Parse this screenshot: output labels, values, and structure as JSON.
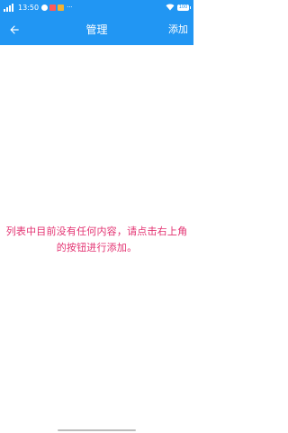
{
  "status_bar": {
    "time": "13:50",
    "battery": "100",
    "more": "···",
    "icons": [
      "signal-icon",
      "help-icon",
      "app-notification-icon",
      "app-notification-icon",
      "wifi-icon",
      "battery-icon"
    ]
  },
  "app_bar": {
    "title": "管理",
    "add_label": "添加",
    "back_icon": "arrow-left-icon",
    "color": "#2196F3"
  },
  "content": {
    "empty_message": "列表中目前没有任何内容，请点击右上角的按钮进行添加。",
    "message_color": "#E33271"
  }
}
